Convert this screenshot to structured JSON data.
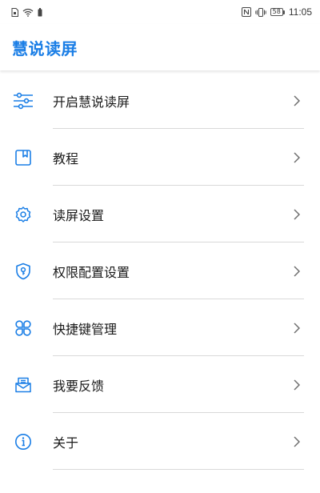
{
  "status_bar": {
    "time": "11:05",
    "battery_level": "58",
    "icons": [
      "sim-card-icon",
      "wifi-icon",
      "battery-saver-icon",
      "nfc-icon",
      "vibrate-icon",
      "battery-icon"
    ]
  },
  "header": {
    "title": "慧说读屏"
  },
  "colors": {
    "accent": "#1a7ee6",
    "divider": "#d9d9d9",
    "text": "#1a1a1a",
    "chevron": "#6e6e6e"
  },
  "menu": {
    "items": [
      {
        "label": "开启慧说读屏",
        "icon": "sliders-icon"
      },
      {
        "label": "教程",
        "icon": "book-icon"
      },
      {
        "label": "读屏设置",
        "icon": "gear-icon"
      },
      {
        "label": "权限配置设置",
        "icon": "shield-key-icon"
      },
      {
        "label": "快捷键管理",
        "icon": "clover-icon"
      },
      {
        "label": "我要反馈",
        "icon": "feedback-mail-icon"
      },
      {
        "label": "关于",
        "icon": "info-icon"
      }
    ]
  }
}
